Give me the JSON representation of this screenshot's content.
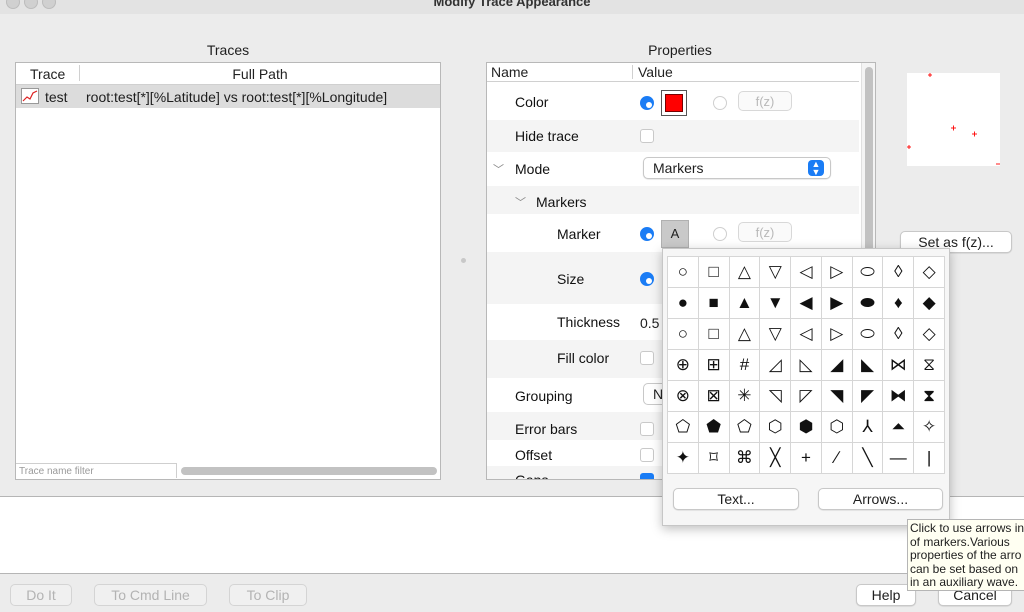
{
  "window": {
    "title": "Modify Trace Appearance"
  },
  "traces_panel": {
    "title": "Traces",
    "col_trace": "Trace",
    "col_path": "Full Path",
    "rows": [
      {
        "name": "test",
        "path": "root:test[*][%Latitude] vs root:test[*][%Longitude]"
      }
    ],
    "filter_placeholder": "Trace name filter"
  },
  "properties_panel": {
    "title": "Properties",
    "col_name": "Name",
    "col_value": "Value",
    "color_label": "Color",
    "color_value": "#ff0000",
    "fz_label": "f(z)",
    "hide_trace_label": "Hide trace",
    "mode_label": "Mode",
    "mode_value": "Markers",
    "markers_label": "Markers",
    "marker_label": "Marker",
    "marker_value": "A",
    "size_label": "Size",
    "thickness_label": "Thickness",
    "thickness_value": "0.5",
    "fill_color_label": "Fill color",
    "grouping_label": "Grouping",
    "grouping_value": "N",
    "error_bars_label": "Error bars",
    "offset_label": "Offset",
    "gaps_label": "Gaps"
  },
  "set_fz_button": "Set as f(z)...",
  "marker_popup": {
    "rows": [
      [
        "○",
        "□",
        "△",
        "▽",
        "◁",
        "▷",
        "⬭",
        "◊",
        "◇"
      ],
      [
        "●",
        "■",
        "▲",
        "▼",
        "◀",
        "▶",
        "⬬",
        "♦",
        "◆"
      ],
      [
        "○",
        "□",
        "△",
        "▽",
        "◁",
        "▷",
        "⬭",
        "◊",
        "◇"
      ],
      [
        "⊕",
        "⊞",
        "#",
        "◿",
        "◺",
        "◢",
        "◣",
        "⋈",
        "⧖"
      ],
      [
        "⊗",
        "⊠",
        "✳",
        "◹",
        "◸",
        "◥",
        "◤",
        "⧓",
        "⧗"
      ],
      [
        "⬠",
        "⬟",
        "⬠",
        "⬡",
        "⬢",
        "⬡",
        "⅄",
        "⏶",
        "✧"
      ],
      [
        "✦",
        "⌑",
        "⌘",
        "╳",
        "+",
        "∕",
        "╲",
        "—",
        "|"
      ]
    ],
    "text_button": "Text...",
    "arrows_button": "Arrows..."
  },
  "tooltip": "Click to use arrows in\nof markers.Various\nproperties of the arro\ncan be set based on\nin an auxiliary wave.",
  "footer": {
    "do_it": "Do It",
    "to_cmd_line": "To Cmd Line",
    "to_clip": "To Clip",
    "help": "Help",
    "cancel": "Cancel"
  }
}
